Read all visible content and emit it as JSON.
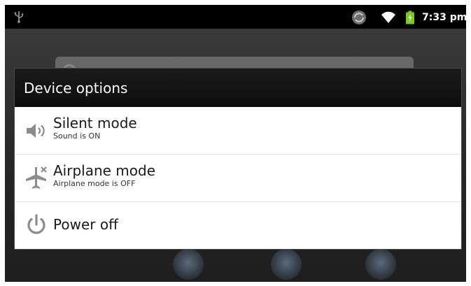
{
  "status_bar": {
    "time": "7:33 pm",
    "icons": [
      "usb-icon",
      "sync-icon",
      "wifi-icon",
      "battery-icon"
    ],
    "battery_color": "#7dc728"
  },
  "dialog": {
    "title": "Device options",
    "items": [
      {
        "title": "Silent mode",
        "subtitle": "Sound is ON",
        "icon": "speaker-icon"
      },
      {
        "title": "Airplane mode",
        "subtitle": "Airplane mode is OFF",
        "icon": "airplane-icon"
      },
      {
        "title": "Power off",
        "icon": "power-icon"
      }
    ]
  }
}
